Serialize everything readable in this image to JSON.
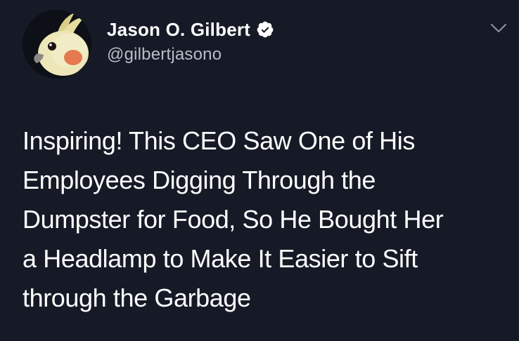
{
  "author": {
    "display_name": "Jason O. Gilbert",
    "handle": "@gilbertjasono",
    "verified": true
  },
  "icons": {
    "verified": "verified-badge-icon",
    "menu": "chevron-down-icon",
    "avatar": "cockatiel-avatar"
  },
  "tweet": {
    "lines": [
      "Inspiring! This CEO Saw One of His",
      "Employees Digging Through the",
      "Dumpster for Food, So He Bought Her",
      "a Headlamp to Make It Easier to Sift",
      "through the Garbage"
    ]
  },
  "colors": {
    "background": "#151a26",
    "text": "#ffffff",
    "secondary_text": "#b8bec8"
  }
}
